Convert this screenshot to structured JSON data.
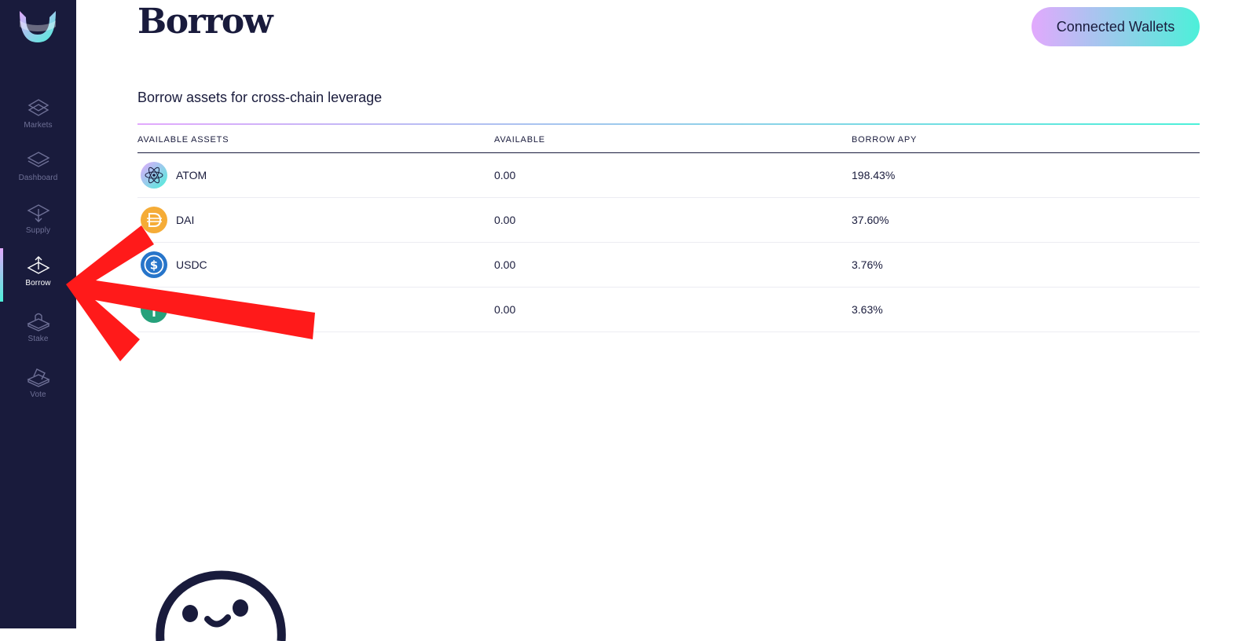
{
  "page": {
    "title": "Borrow",
    "subtitle": "Borrow assets for cross-chain leverage"
  },
  "header": {
    "wallet_button": "Connected Wallets"
  },
  "sidebar": {
    "items": [
      {
        "label": "Markets",
        "icon": "markets-icon",
        "active": false
      },
      {
        "label": "Dashboard",
        "icon": "dashboard-icon",
        "active": false
      },
      {
        "label": "Supply",
        "icon": "supply-icon",
        "active": false
      },
      {
        "label": "Borrow",
        "icon": "borrow-icon",
        "active": true
      },
      {
        "label": "Stake",
        "icon": "stake-icon",
        "active": false
      },
      {
        "label": "Vote",
        "icon": "vote-icon",
        "active": false
      }
    ]
  },
  "table": {
    "columns": [
      "AVAILABLE ASSETS",
      "AVAILABLE",
      "BORROW APY"
    ],
    "rows": [
      {
        "asset": "ATOM",
        "available": "0.00",
        "apy": "198.43%",
        "icon": "atom-icon"
      },
      {
        "asset": "DAI",
        "available": "0.00",
        "apy": "37.60%",
        "icon": "dai-icon"
      },
      {
        "asset": "USDC",
        "available": "0.00",
        "apy": "3.76%",
        "icon": "usdc-icon"
      },
      {
        "asset": "",
        "available": "0.00",
        "apy": "3.63%",
        "icon": "usdt-icon"
      }
    ]
  },
  "colors": {
    "sidebar": "#191b3c",
    "accent_start": "#e2a9fd",
    "accent_end": "#4cf0d9",
    "arrow": "#ff1a1a"
  }
}
